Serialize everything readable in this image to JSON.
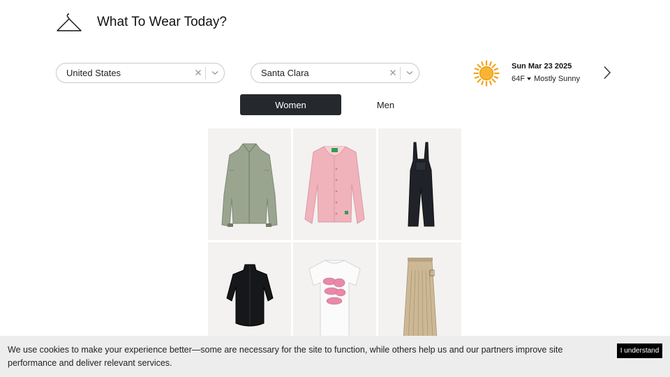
{
  "header": {
    "title": "What To Wear Today?",
    "logo_icon": "hanger-icon"
  },
  "country_select": {
    "value": "United States"
  },
  "city_select": {
    "value": "Santa Clara"
  },
  "weather": {
    "date": "Sun Mar 23 2025",
    "temperature": "64F",
    "condition": "Mostly Sunny",
    "icon": "sun-icon"
  },
  "gender_tabs": [
    {
      "label": "Women",
      "active": true
    },
    {
      "label": "Men",
      "active": false
    }
  ],
  "products": [
    {
      "item": "green-jacket"
    },
    {
      "item": "pink-cardigan"
    },
    {
      "item": "black-overalls"
    },
    {
      "item": "black-zip-top"
    },
    {
      "item": "white-graphic-tee"
    },
    {
      "item": "khaki-pleated-skirt"
    }
  ],
  "cookie_banner": {
    "text": "We use cookies to make your experience better—some are necessary for the site to function, while others help us and our partners improve site performance and deliver relevant services.",
    "button_label": "I understand"
  },
  "colors": {
    "accent": "#25282c",
    "banner_bg": "#ededed",
    "card_bg": "#f3f2f1"
  }
}
